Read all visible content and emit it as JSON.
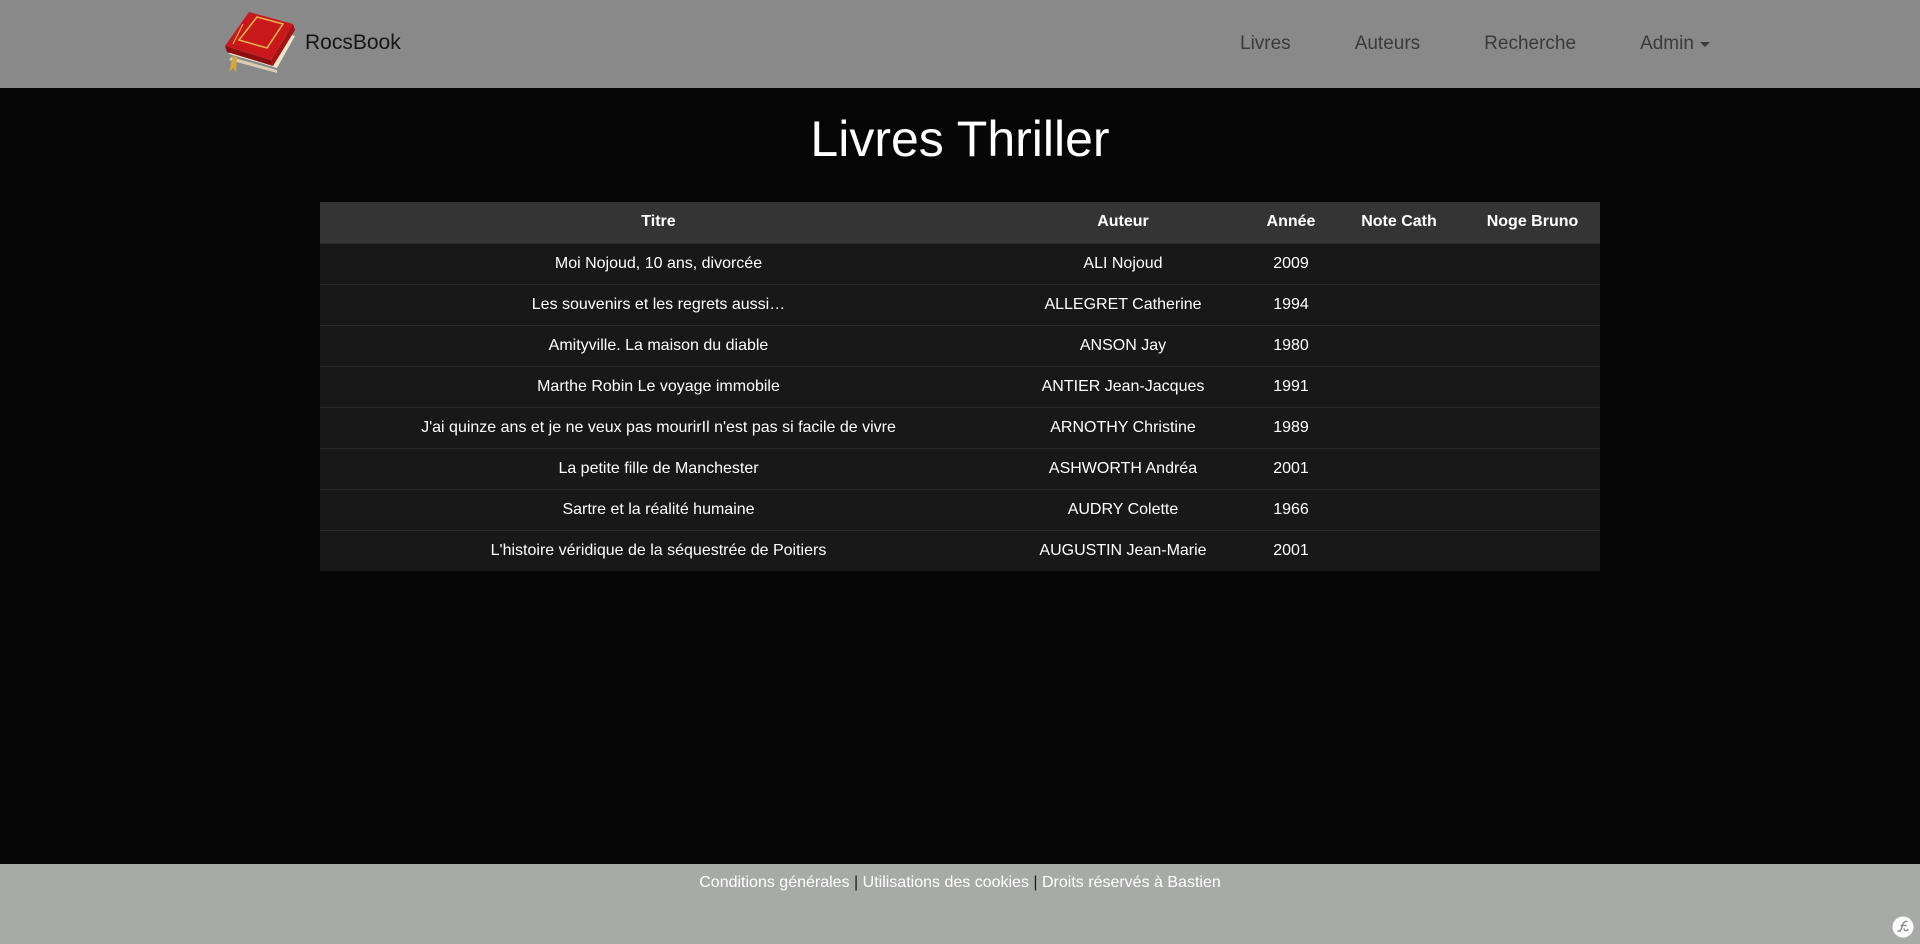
{
  "navbar": {
    "brand": "RocsBook",
    "links": [
      {
        "label": "Livres"
      },
      {
        "label": "Auteurs"
      },
      {
        "label": "Recherche"
      },
      {
        "label": "Admin"
      }
    ]
  },
  "page": {
    "title": "Livres Thriller"
  },
  "table": {
    "headers": [
      "Titre",
      "Auteur",
      "Année",
      "Note Cath",
      "Noge Bruno"
    ],
    "rows": [
      {
        "titre": "Moi Nojoud, 10 ans, divorcée",
        "auteur": "ALI Nojoud",
        "annee": "2009",
        "note_cath": "",
        "note_bruno": ""
      },
      {
        "titre": "Les souvenirs et les regrets aussi…",
        "auteur": "ALLEGRET Catherine",
        "annee": "1994",
        "note_cath": "",
        "note_bruno": ""
      },
      {
        "titre": "Amityville. La maison du diable",
        "auteur": "ANSON Jay",
        "annee": "1980",
        "note_cath": "",
        "note_bruno": ""
      },
      {
        "titre": "Marthe Robin Le voyage immobile",
        "auteur": "ANTIER Jean-Jacques",
        "annee": "1991",
        "note_cath": "",
        "note_bruno": ""
      },
      {
        "titre": "J'ai quinze ans et je ne veux pas mourirIl n'est pas si facile de vivre",
        "auteur": "ARNOTHY Christine",
        "annee": "1989",
        "note_cath": "",
        "note_bruno": ""
      },
      {
        "titre": "La petite fille de Manchester",
        "auteur": "ASHWORTH Andréa",
        "annee": "2001",
        "note_cath": "",
        "note_bruno": ""
      },
      {
        "titre": "Sartre et la réalité humaine",
        "auteur": "AUDRY Colette",
        "annee": "1966",
        "note_cath": "",
        "note_bruno": ""
      },
      {
        "titre": "L'histoire véridique de la séquestrée de Poitiers",
        "auteur": "AUGUSTIN Jean-Marie",
        "annee": "2001",
        "note_cath": "",
        "note_bruno": ""
      }
    ]
  },
  "footer": {
    "links": [
      "Conditions générales",
      "Utilisations des cookies",
      "Droits réservés à Bastien"
    ],
    "separator": "|"
  },
  "colors": {
    "navbar_bg": "#898989",
    "body_bg": "#060606",
    "table_header_bg": "#343434",
    "table_row_bg": "#181818",
    "footer_bg": "#a8aaa8"
  },
  "icons": {
    "brand_logo": "book-icon",
    "framework_logo": "symfony-icon"
  }
}
